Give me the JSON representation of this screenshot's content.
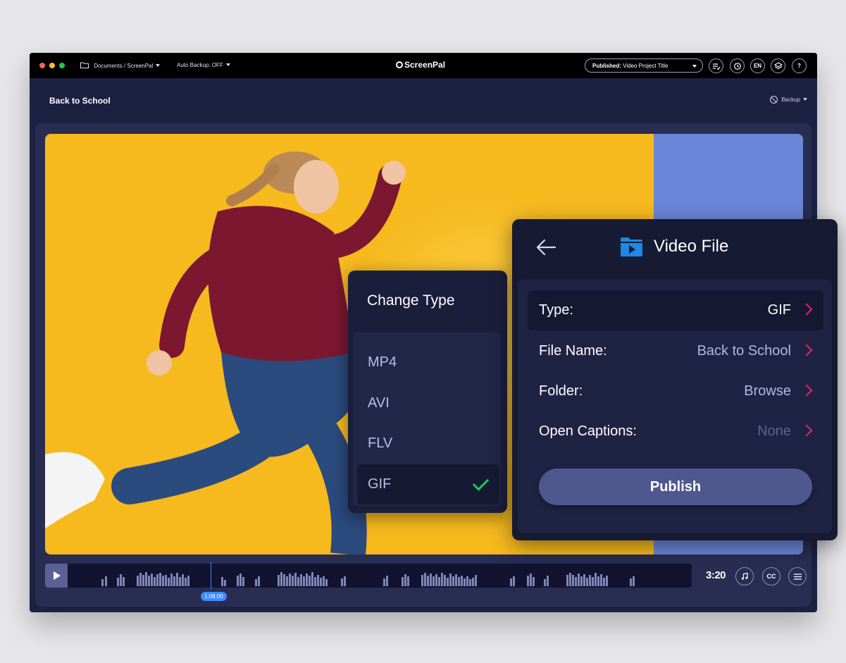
{
  "titlebar": {
    "folder_path": "Documents / ScreenPal",
    "auto_backup_label": "Auto Backup:",
    "auto_backup_value": "OFF",
    "logo": "ScreenPal",
    "published_label": "Published:",
    "published_title": "Video Project Title",
    "lang": "EN",
    "help": "?"
  },
  "header": {
    "project_title": "Back to School",
    "backup_label": "Backup"
  },
  "timeline": {
    "playhead_time": "1:08.00",
    "duration": "3:20",
    "cc_label": "CC"
  },
  "change_type": {
    "title": "Change Type",
    "options": [
      "MP4",
      "AVI",
      "FLV",
      "GIF"
    ],
    "selected": "GIF"
  },
  "video_file": {
    "title": "Video File",
    "rows": [
      {
        "label": "Type:",
        "value": "GIF"
      },
      {
        "label": "File Name:",
        "value": "Back to School"
      },
      {
        "label": "Folder:",
        "value": "Browse"
      },
      {
        "label": "Open Captions:",
        "value": "None"
      }
    ],
    "publish_label": "Publish"
  },
  "colors": {
    "accent": "#e8226b",
    "check": "#22c55e",
    "playhead": "#3d8bff",
    "video_bg": "#f6b91e"
  }
}
